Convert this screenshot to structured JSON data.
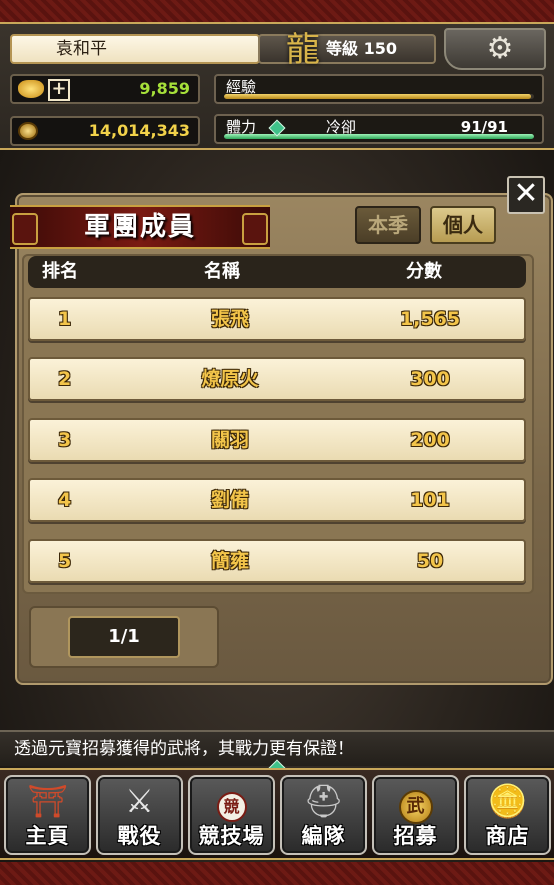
{
  "player": {
    "name": "袁和平",
    "level_text": "等級 150",
    "gold": "9,859",
    "coins": "14,014,343"
  },
  "bars": {
    "exp_label": "經驗",
    "exp_progress": 0.99,
    "stamina_label": "體力",
    "cooldown_label": "冷卻",
    "stamina_value": "91/91",
    "stamina_progress": 1.0
  },
  "panel": {
    "title": "軍團成員",
    "tabs": [
      {
        "label": "本季",
        "selected": false
      },
      {
        "label": "個人",
        "selected": true
      }
    ],
    "close_icon": "close-icon",
    "columns": [
      "排名",
      "名稱",
      "分數"
    ],
    "rows": [
      {
        "rank": "1",
        "name": "張飛",
        "score": "1,565"
      },
      {
        "rank": "2",
        "name": "燎原火",
        "score": "300"
      },
      {
        "rank": "3",
        "name": "關羽",
        "score": "200"
      },
      {
        "rank": "4",
        "name": "劉備",
        "score": "101"
      },
      {
        "rank": "5",
        "name": "簡雍",
        "score": "50"
      }
    ],
    "page": "1/1"
  },
  "tip": "透過元寶招募獲得的武將，其戰力更有保證！",
  "nav": [
    {
      "label": "主頁",
      "icon": "palace-icon"
    },
    {
      "label": "戰役",
      "icon": "crossed-swords-icon"
    },
    {
      "label": "競技場",
      "icon": "arena-icon",
      "badge": "競"
    },
    {
      "label": "編隊",
      "icon": "helmet-icon"
    },
    {
      "label": "招募",
      "icon": "recruit-icon",
      "badge": "武"
    },
    {
      "label": "商店",
      "icon": "gold-ingot-icon"
    }
  ],
  "colors": {
    "gold_value": "#a6e03a",
    "coin_value": "#f2d24a",
    "score_text": "#f3c54a",
    "banner_red": "#7a1a12"
  }
}
